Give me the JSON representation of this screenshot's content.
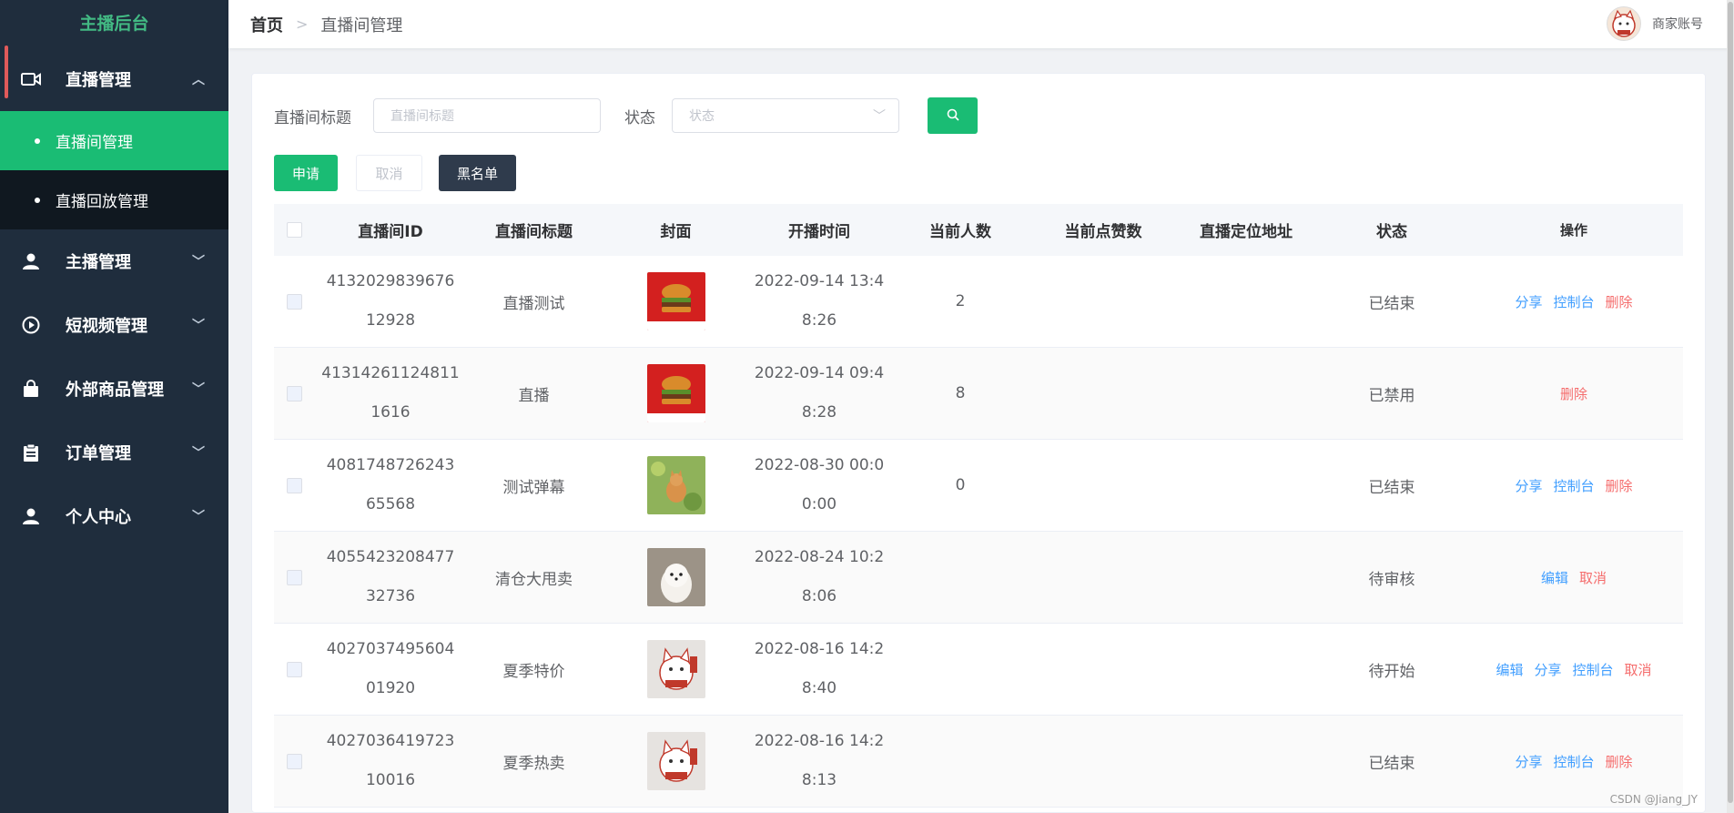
{
  "sidebar": {
    "brand": "主播后台",
    "live_group": {
      "label": "直播管理",
      "icon": "video-camera-icon",
      "sub_items": [
        {
          "label": "直播间管理",
          "active": true
        },
        {
          "label": "直播回放管理",
          "active": false
        }
      ]
    },
    "items": [
      {
        "label": "主播管理",
        "icon": "user-icon"
      },
      {
        "label": "短视频管理",
        "icon": "play-circle-icon"
      },
      {
        "label": "外部商品管理",
        "icon": "shopping-bag-icon"
      },
      {
        "label": "订单管理",
        "icon": "clipboard-icon"
      },
      {
        "label": "个人中心",
        "icon": "user-icon"
      }
    ]
  },
  "header": {
    "breadcrumb_home": "首页",
    "breadcrumb_current": "直播间管理",
    "account_name": "商家账号"
  },
  "filters": {
    "title_label": "直播间标题",
    "title_placeholder": "直播间标题",
    "status_label": "状态",
    "status_placeholder": "状态"
  },
  "actions": {
    "apply": "申请",
    "cancel": "取消",
    "blacklist": "黑名单"
  },
  "table": {
    "columns": [
      "直播间ID",
      "直播间标题",
      "封面",
      "开播时间",
      "当前人数",
      "当前点赞数",
      "直播定位地址",
      "状态",
      "操作"
    ],
    "rows": [
      {
        "id_l1": "4132029839676",
        "id_l2": "12928",
        "title": "直播测试",
        "cover": "burger",
        "time_l1": "2022-09-14 13:4",
        "time_l2": "8:26",
        "count": "2",
        "likes": "",
        "location": "",
        "status": "已结束",
        "ops": [
          [
            "分享",
            "blue"
          ],
          [
            "控制台",
            "blue"
          ],
          [
            "删除",
            "red"
          ]
        ]
      },
      {
        "id_l1": "41314261124811",
        "id_l2": "1616",
        "title": "直播",
        "cover": "burger",
        "time_l1": "2022-09-14 09:4",
        "time_l2": "8:28",
        "count": "8",
        "likes": "",
        "location": "",
        "status": "已禁用",
        "ops": [
          [
            "删除",
            "red"
          ]
        ]
      },
      {
        "id_l1": "4081748726243",
        "id_l2": "65568",
        "title": "测试弹幕",
        "cover": "cat-grass",
        "time_l1": "2022-08-30 00:0",
        "time_l2": "0:00",
        "count": "0",
        "likes": "",
        "location": "",
        "status": "已结束",
        "ops": [
          [
            "分享",
            "blue"
          ],
          [
            "控制台",
            "blue"
          ],
          [
            "删除",
            "red"
          ]
        ]
      },
      {
        "id_l1": "4055423208477",
        "id_l2": "32736",
        "title": "清仓大甩卖",
        "cover": "puppy",
        "time_l1": "2022-08-24 10:2",
        "time_l2": "8:06",
        "count": "",
        "likes": "",
        "location": "",
        "status": "待审核",
        "ops": [
          [
            "编辑",
            "blue"
          ],
          [
            "取消",
            "red"
          ]
        ]
      },
      {
        "id_l1": "4027037495604",
        "id_l2": "01920",
        "title": "夏季特价",
        "cover": "lucky-cat",
        "time_l1": "2022-08-16 14:2",
        "time_l2": "8:40",
        "count": "",
        "likes": "",
        "location": "",
        "status": "待开始",
        "ops": [
          [
            "编辑",
            "blue"
          ],
          [
            "分享",
            "blue"
          ],
          [
            "控制台",
            "blue"
          ],
          [
            "取消",
            "red"
          ]
        ]
      },
      {
        "id_l1": "4027036419723",
        "id_l2": "10016",
        "title": "夏季热卖",
        "cover": "lucky-cat",
        "time_l1": "2022-08-16 14:2",
        "time_l2": "8:13",
        "count": "",
        "likes": "",
        "location": "",
        "status": "已结束",
        "ops": [
          [
            "分享",
            "blue"
          ],
          [
            "控制台",
            "blue"
          ],
          [
            "删除",
            "red"
          ]
        ]
      }
    ]
  },
  "watermark": "CSDN @Jiang_JY",
  "colors": {
    "sidebar_bg": "#1f2d3d",
    "brand": "#42b983",
    "accent": "#1abc74",
    "link_blue": "#409eff",
    "danger_red": "#f56c6c",
    "dark_button": "#2f3b4c"
  }
}
